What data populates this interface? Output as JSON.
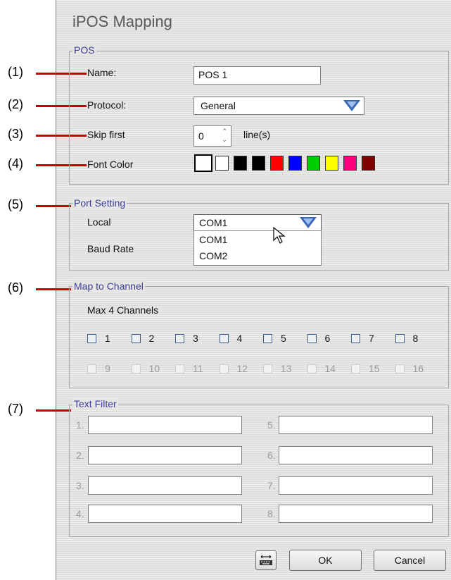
{
  "dialog": {
    "title": "iPOS Mapping"
  },
  "callouts": [
    "(1)",
    "(2)",
    "(3)",
    "(4)",
    "(5)",
    "(6)",
    "(7)"
  ],
  "pos": {
    "legend": "POS",
    "name_label": "Name:",
    "name_value": "POS 1",
    "protocol_label": "Protocol:",
    "protocol_value": "General",
    "skip_label": "Skip  first",
    "skip_value": "0",
    "skip_unit": "line(s)",
    "font_color_label": "Font Color",
    "font_color_selected": "#ffffff",
    "font_colors": [
      "#ffffff",
      "#000000",
      "#000000",
      "#ff0000",
      "#0000ff",
      "#00cc00",
      "#ffff00",
      "#ff0080",
      "#800000"
    ]
  },
  "port": {
    "legend": "Port Setting",
    "local_label": "Local",
    "local_value": "COM1",
    "baud_label": "Baud Rate",
    "options": [
      "COM1",
      "COM2"
    ]
  },
  "channel": {
    "legend": "Map to Channel",
    "max_text": "Max 4 Channels",
    "row1": [
      "1",
      "2",
      "3",
      "4",
      "5",
      "6",
      "7",
      "8"
    ],
    "row2": [
      "9",
      "10",
      "11",
      "12",
      "13",
      "14",
      "15",
      "16"
    ]
  },
  "filter": {
    "legend": "Text Filter",
    "numbers": [
      "1.",
      "2.",
      "3.",
      "4.",
      "5.",
      "6.",
      "7.",
      "8."
    ]
  },
  "buttons": {
    "ok": "OK",
    "cancel": "Cancel",
    "keyboard_icon": "keyboard-icon"
  },
  "colors": {
    "legend": "#3b3c97",
    "callout_line": "#c80000",
    "dropdown_arrow": "#3a67b7"
  }
}
